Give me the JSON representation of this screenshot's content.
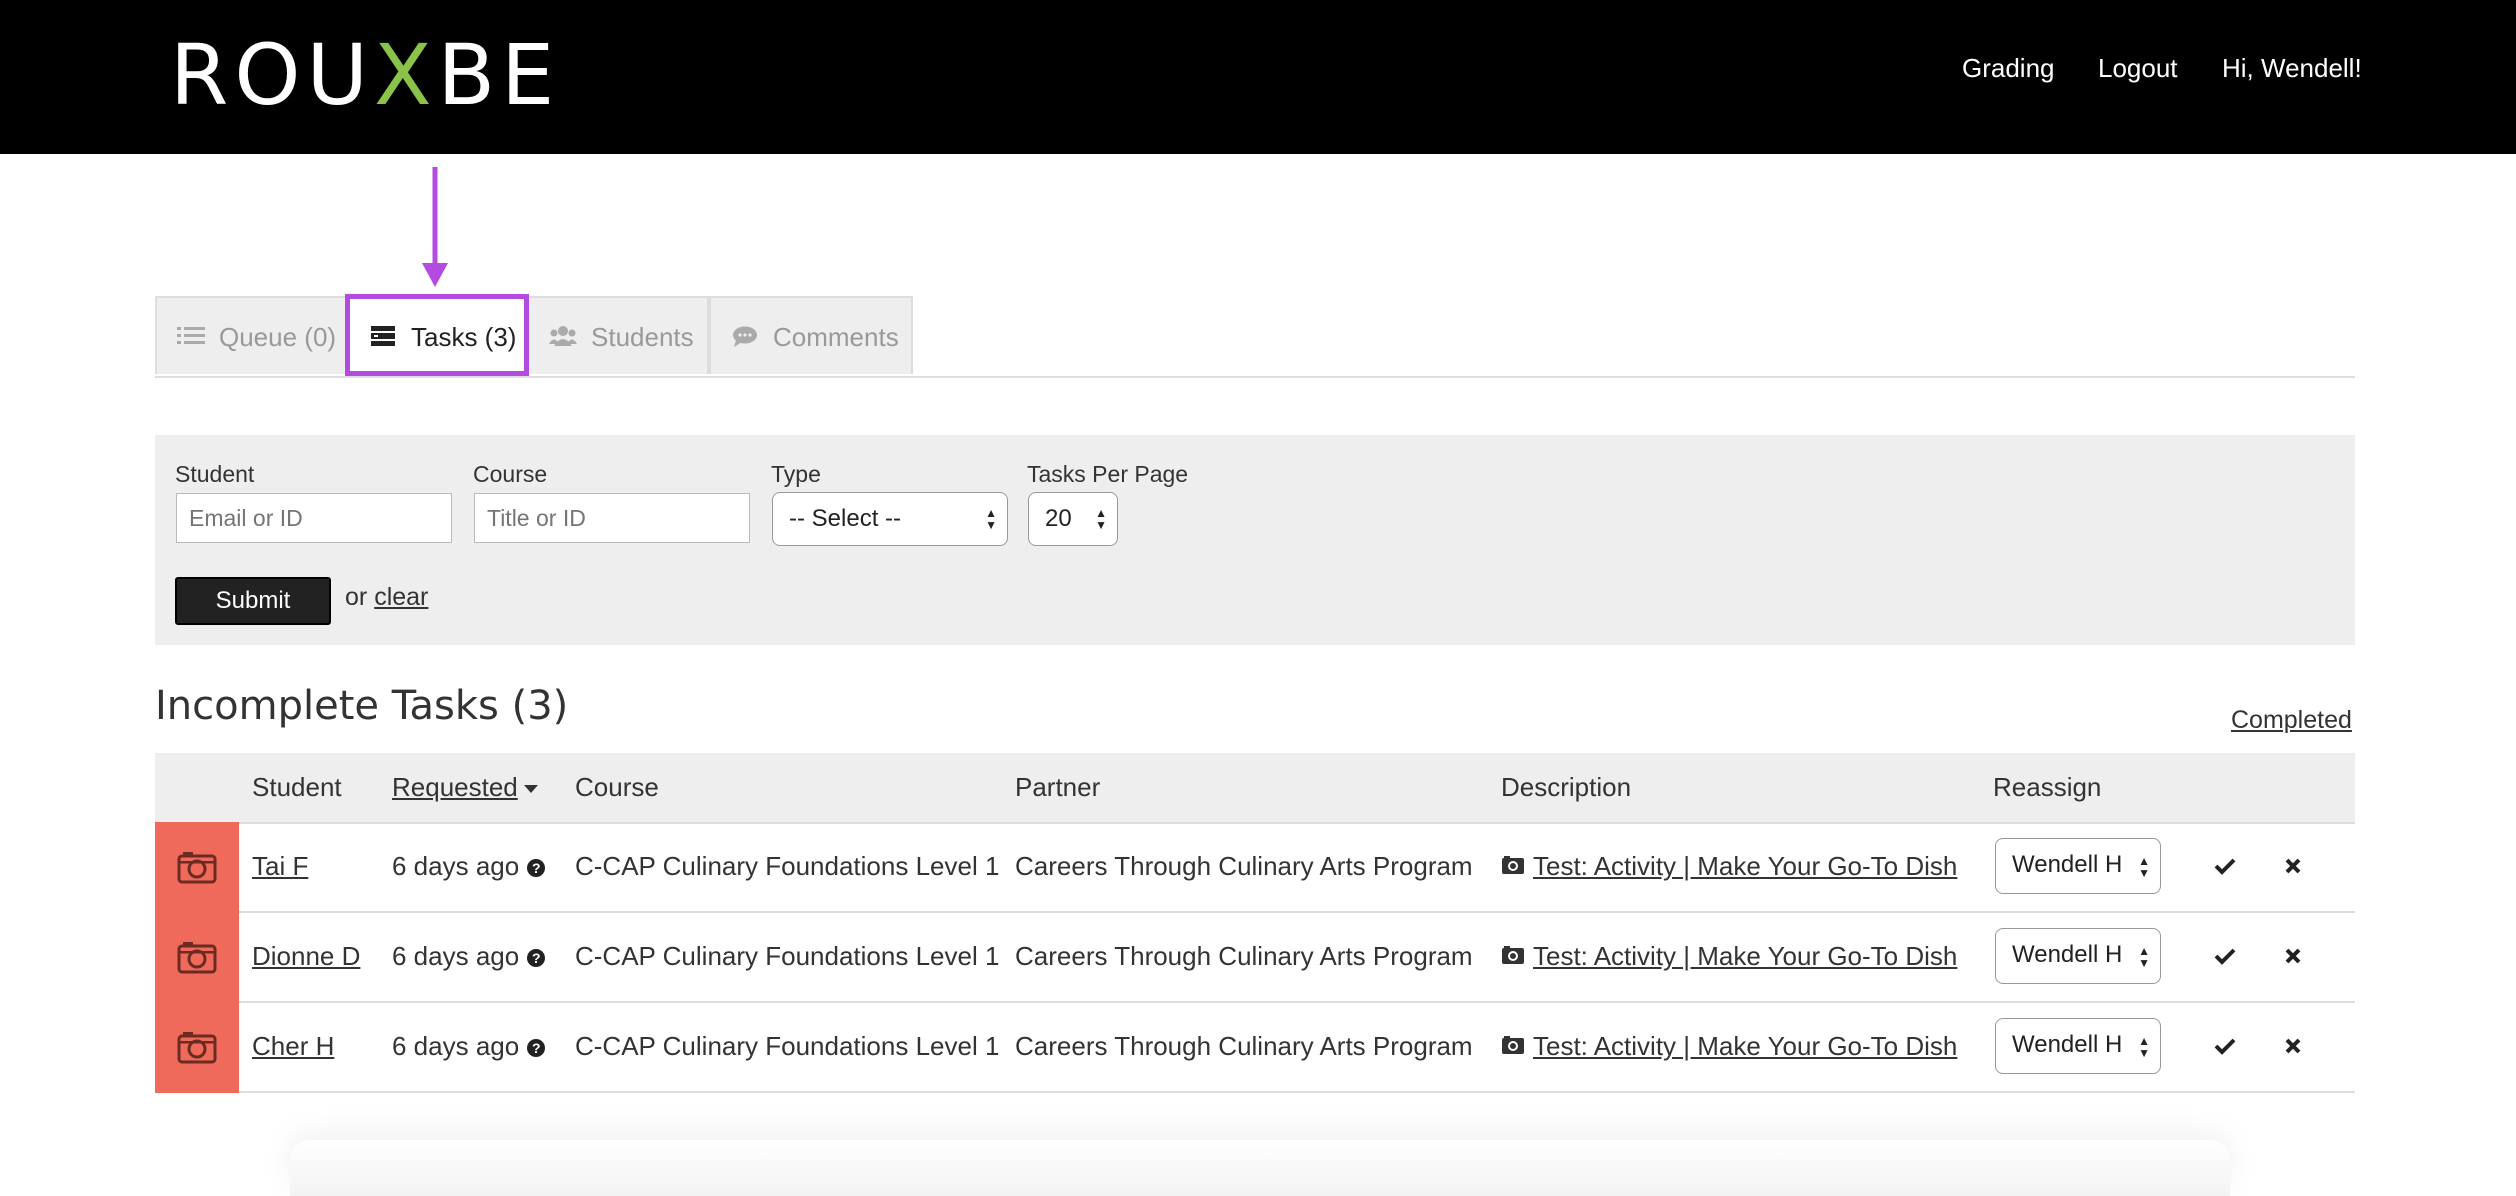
{
  "header": {
    "logo_text": "ROUXBE",
    "nav": {
      "grading": "Grading",
      "logout": "Logout",
      "greeting": "Hi, Wendell!"
    }
  },
  "tabs": [
    {
      "label": "Queue (0)",
      "icon": "list-icon"
    },
    {
      "label": "Tasks (3)",
      "icon": "tasks-icon",
      "active": true
    },
    {
      "label": "Students",
      "icon": "users-icon"
    },
    {
      "label": "Comments",
      "icon": "comment-icon"
    }
  ],
  "filters": {
    "student": {
      "label": "Student",
      "placeholder": "Email or ID"
    },
    "course": {
      "label": "Course",
      "placeholder": "Title or ID"
    },
    "type": {
      "label": "Type",
      "value": "-- Select --"
    },
    "per_page": {
      "label": "Tasks Per Page",
      "value": "20"
    },
    "submit_label": "Submit",
    "or_text": "or",
    "clear_label": "clear"
  },
  "section": {
    "title": "Incomplete Tasks (3)",
    "completed_link": "Completed"
  },
  "table": {
    "headers": {
      "student": "Student",
      "requested": "Requested",
      "course": "Course",
      "partner": "Partner",
      "description": "Description",
      "reassign": "Reassign"
    },
    "rows": [
      {
        "student": "Tai F",
        "requested": "6 days ago",
        "course": "C-CAP Culinary Foundations Level 1",
        "partner": "Careers Through Culinary Arts Program",
        "description": "Test: Activity | Make Your Go-To Dish",
        "reassign": "Wendell H"
      },
      {
        "student": "Dionne D",
        "requested": "6 days ago",
        "course": "C-CAP Culinary Foundations Level 1",
        "partner": "Careers Through Culinary Arts Program",
        "description": "Test: Activity | Make Your Go-To Dish",
        "reassign": "Wendell H"
      },
      {
        "student": "Cher H",
        "requested": "6 days ago",
        "course": "C-CAP Culinary Foundations Level 1",
        "partner": "Careers Through Culinary Arts Program",
        "description": "Test: Activity | Make Your Go-To Dish",
        "reassign": "Wendell H"
      }
    ]
  },
  "colors": {
    "accent_highlight": "#b44be1",
    "row_marker": "#ef6a5a",
    "logo_x": "#8bc34a",
    "topbar": "#000000"
  }
}
